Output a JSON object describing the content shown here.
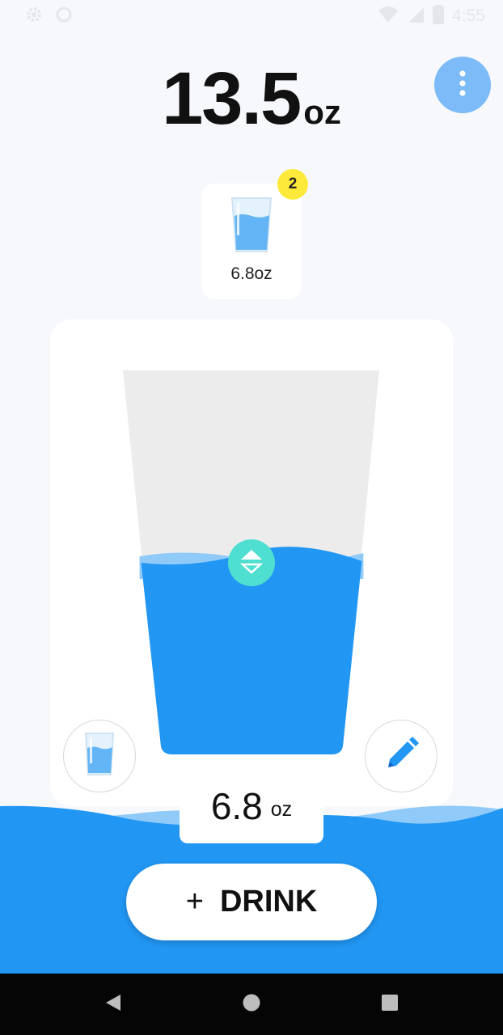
{
  "status_bar": {
    "time": "4:55",
    "icons": [
      "settings-icon",
      "sync-icon",
      "wifi-icon",
      "signal-icon",
      "battery-icon"
    ]
  },
  "total": {
    "value": "13.5",
    "unit": "oz"
  },
  "menu": {
    "icon": "more-vertical-icon"
  },
  "cup_selector": {
    "size_label": "6.8oz",
    "count": "2"
  },
  "glass": {
    "fill_fraction": 0.52,
    "handle_icon": "up-down-arrows-icon",
    "left_button_icon": "cup-icon",
    "right_button_icon": "pencil-icon"
  },
  "amount": {
    "value": "6.8",
    "unit": "oz"
  },
  "drink_button": {
    "plus": "+",
    "label": "DRINK"
  },
  "colors": {
    "water": "#2196f3",
    "water_light": "#90caf9",
    "empty_glass": "#ececec",
    "handle": "#4fdfd0",
    "badge": "#fde93a",
    "menu_button": "#7cbbf7"
  },
  "nav": {
    "back_icon": "back-icon",
    "home_icon": "home-icon",
    "recents_icon": "recents-icon"
  }
}
